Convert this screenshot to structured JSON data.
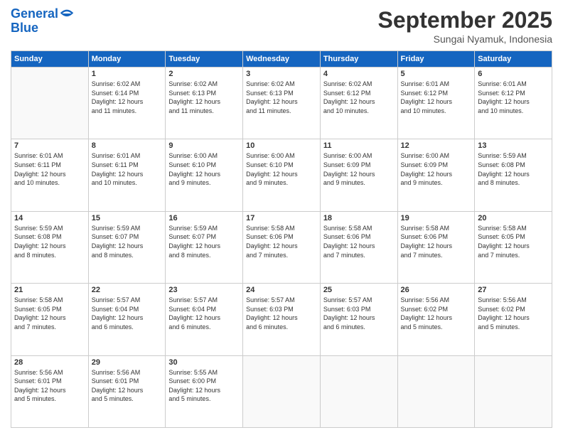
{
  "logo": {
    "line1": "General",
    "line2": "Blue"
  },
  "title": {
    "month_year": "September 2025",
    "location": "Sungai Nyamuk, Indonesia"
  },
  "days_header": [
    "Sunday",
    "Monday",
    "Tuesday",
    "Wednesday",
    "Thursday",
    "Friday",
    "Saturday"
  ],
  "weeks": [
    [
      {
        "day": "",
        "info": ""
      },
      {
        "day": "1",
        "info": "Sunrise: 6:02 AM\nSunset: 6:14 PM\nDaylight: 12 hours\nand 11 minutes."
      },
      {
        "day": "2",
        "info": "Sunrise: 6:02 AM\nSunset: 6:13 PM\nDaylight: 12 hours\nand 11 minutes."
      },
      {
        "day": "3",
        "info": "Sunrise: 6:02 AM\nSunset: 6:13 PM\nDaylight: 12 hours\nand 11 minutes."
      },
      {
        "day": "4",
        "info": "Sunrise: 6:02 AM\nSunset: 6:12 PM\nDaylight: 12 hours\nand 10 minutes."
      },
      {
        "day": "5",
        "info": "Sunrise: 6:01 AM\nSunset: 6:12 PM\nDaylight: 12 hours\nand 10 minutes."
      },
      {
        "day": "6",
        "info": "Sunrise: 6:01 AM\nSunset: 6:12 PM\nDaylight: 12 hours\nand 10 minutes."
      }
    ],
    [
      {
        "day": "7",
        "info": "Sunrise: 6:01 AM\nSunset: 6:11 PM\nDaylight: 12 hours\nand 10 minutes."
      },
      {
        "day": "8",
        "info": "Sunrise: 6:01 AM\nSunset: 6:11 PM\nDaylight: 12 hours\nand 10 minutes."
      },
      {
        "day": "9",
        "info": "Sunrise: 6:00 AM\nSunset: 6:10 PM\nDaylight: 12 hours\nand 9 minutes."
      },
      {
        "day": "10",
        "info": "Sunrise: 6:00 AM\nSunset: 6:10 PM\nDaylight: 12 hours\nand 9 minutes."
      },
      {
        "day": "11",
        "info": "Sunrise: 6:00 AM\nSunset: 6:09 PM\nDaylight: 12 hours\nand 9 minutes."
      },
      {
        "day": "12",
        "info": "Sunrise: 6:00 AM\nSunset: 6:09 PM\nDaylight: 12 hours\nand 9 minutes."
      },
      {
        "day": "13",
        "info": "Sunrise: 5:59 AM\nSunset: 6:08 PM\nDaylight: 12 hours\nand 8 minutes."
      }
    ],
    [
      {
        "day": "14",
        "info": "Sunrise: 5:59 AM\nSunset: 6:08 PM\nDaylight: 12 hours\nand 8 minutes."
      },
      {
        "day": "15",
        "info": "Sunrise: 5:59 AM\nSunset: 6:07 PM\nDaylight: 12 hours\nand 8 minutes."
      },
      {
        "day": "16",
        "info": "Sunrise: 5:59 AM\nSunset: 6:07 PM\nDaylight: 12 hours\nand 8 minutes."
      },
      {
        "day": "17",
        "info": "Sunrise: 5:58 AM\nSunset: 6:06 PM\nDaylight: 12 hours\nand 7 minutes."
      },
      {
        "day": "18",
        "info": "Sunrise: 5:58 AM\nSunset: 6:06 PM\nDaylight: 12 hours\nand 7 minutes."
      },
      {
        "day": "19",
        "info": "Sunrise: 5:58 AM\nSunset: 6:06 PM\nDaylight: 12 hours\nand 7 minutes."
      },
      {
        "day": "20",
        "info": "Sunrise: 5:58 AM\nSunset: 6:05 PM\nDaylight: 12 hours\nand 7 minutes."
      }
    ],
    [
      {
        "day": "21",
        "info": "Sunrise: 5:58 AM\nSunset: 6:05 PM\nDaylight: 12 hours\nand 7 minutes."
      },
      {
        "day": "22",
        "info": "Sunrise: 5:57 AM\nSunset: 6:04 PM\nDaylight: 12 hours\nand 6 minutes."
      },
      {
        "day": "23",
        "info": "Sunrise: 5:57 AM\nSunset: 6:04 PM\nDaylight: 12 hours\nand 6 minutes."
      },
      {
        "day": "24",
        "info": "Sunrise: 5:57 AM\nSunset: 6:03 PM\nDaylight: 12 hours\nand 6 minutes."
      },
      {
        "day": "25",
        "info": "Sunrise: 5:57 AM\nSunset: 6:03 PM\nDaylight: 12 hours\nand 6 minutes."
      },
      {
        "day": "26",
        "info": "Sunrise: 5:56 AM\nSunset: 6:02 PM\nDaylight: 12 hours\nand 5 minutes."
      },
      {
        "day": "27",
        "info": "Sunrise: 5:56 AM\nSunset: 6:02 PM\nDaylight: 12 hours\nand 5 minutes."
      }
    ],
    [
      {
        "day": "28",
        "info": "Sunrise: 5:56 AM\nSunset: 6:01 PM\nDaylight: 12 hours\nand 5 minutes."
      },
      {
        "day": "29",
        "info": "Sunrise: 5:56 AM\nSunset: 6:01 PM\nDaylight: 12 hours\nand 5 minutes."
      },
      {
        "day": "30",
        "info": "Sunrise: 5:55 AM\nSunset: 6:00 PM\nDaylight: 12 hours\nand 5 minutes."
      },
      {
        "day": "",
        "info": ""
      },
      {
        "day": "",
        "info": ""
      },
      {
        "day": "",
        "info": ""
      },
      {
        "day": "",
        "info": ""
      }
    ]
  ]
}
